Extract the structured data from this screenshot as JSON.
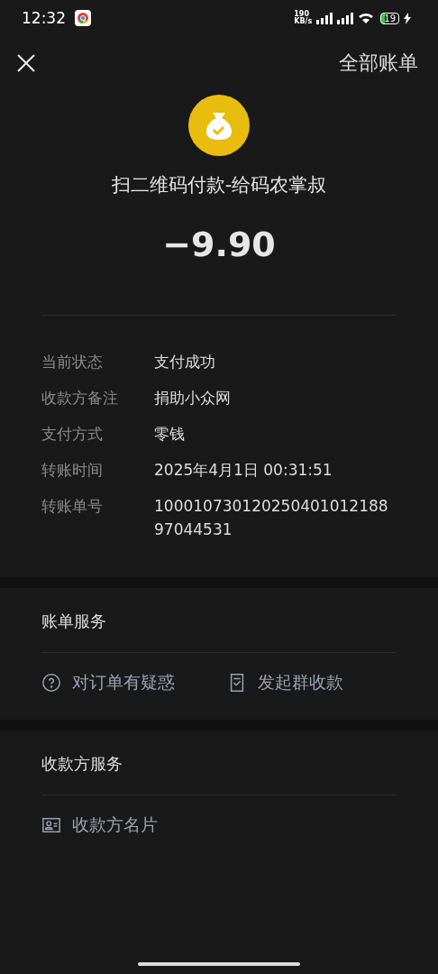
{
  "status_bar": {
    "time": "12:32",
    "net_speed_value": "190",
    "net_speed_unit": "KB/s",
    "battery": "19"
  },
  "nav": {
    "title": "全部账单"
  },
  "payment": {
    "title": "扫二维码付款-给码农掌叔",
    "amount": "−9.90"
  },
  "details": [
    {
      "label": "当前状态",
      "value": "支付成功"
    },
    {
      "label": "收款方备注",
      "value": "捐助小众网"
    },
    {
      "label": "支付方式",
      "value": "零钱"
    },
    {
      "label": "转账时间",
      "value": "2025年4月1日 00:31:51"
    },
    {
      "label": "转账单号",
      "value": "100010730120250401012188 97044531"
    }
  ],
  "sections": [
    {
      "title": "账单服务",
      "actions": [
        {
          "kind": "question",
          "label": "对订单有疑惑"
        },
        {
          "kind": "document",
          "label": "发起群收款"
        }
      ]
    },
    {
      "title": "收款方服务",
      "actions": [
        {
          "kind": "card",
          "label": "收款方名片"
        }
      ]
    }
  ]
}
